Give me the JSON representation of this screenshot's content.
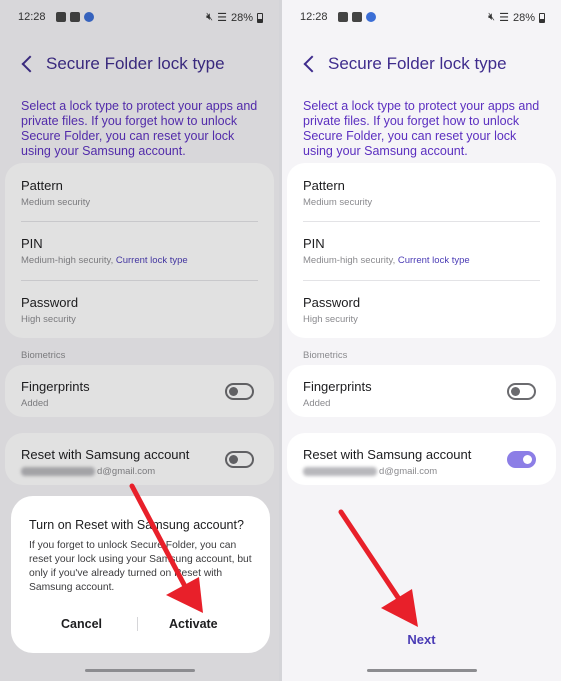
{
  "left": {
    "status": {
      "time": "12:28",
      "battery": "28%"
    },
    "header": {
      "title": "Secure Folder lock type"
    },
    "description": "Select a lock type to protect your apps and private files. If you forget how to unlock Secure Folder, you can reset your lock using your Samsung account.",
    "lock_options": [
      {
        "label": "Pattern",
        "sub": "Medium security",
        "sub_link": ""
      },
      {
        "label": "PIN",
        "sub": "Medium-high security, ",
        "sub_link": "Current lock type"
      },
      {
        "label": "Password",
        "sub": "High security",
        "sub_link": ""
      }
    ],
    "biometrics_label": "Biometrics",
    "fingerprints": {
      "label": "Fingerprints",
      "sub": "Added",
      "toggle_on": false
    },
    "reset": {
      "label": "Reset with Samsung account",
      "email_suffix": "d@gmail.com",
      "toggle_on": false
    },
    "dialog": {
      "title": "Turn on Reset with Samsung account?",
      "body": "If you forget to unlock Secure Folder, you can reset your lock using your Samsung account, but only if you've already turned on Reset with Samsung account.",
      "cancel_label": "Cancel",
      "activate_label": "Activate"
    }
  },
  "right": {
    "status": {
      "time": "12:28",
      "battery": "28%"
    },
    "header": {
      "title": "Secure Folder lock type"
    },
    "description": "Select a lock type to protect your apps and private files. If you forget how to unlock Secure Folder, you can reset your lock using your Samsung account.",
    "lock_options": [
      {
        "label": "Pattern",
        "sub": "Medium security",
        "sub_link": ""
      },
      {
        "label": "PIN",
        "sub": "Medium-high security, ",
        "sub_link": "Current lock type"
      },
      {
        "label": "Password",
        "sub": "High security",
        "sub_link": ""
      }
    ],
    "biometrics_label": "Biometrics",
    "fingerprints": {
      "label": "Fingerprints",
      "sub": "Added",
      "toggle_on": false
    },
    "reset": {
      "label": "Reset with Samsung account",
      "email_suffix": "d@gmail.com",
      "toggle_on": true
    },
    "next_label": "Next"
  },
  "colors": {
    "accent": "#4a3bb5",
    "title": "#3f2c8d",
    "annotation_arrow": "#e8202a",
    "toggle_on": "#8c7ee6"
  }
}
